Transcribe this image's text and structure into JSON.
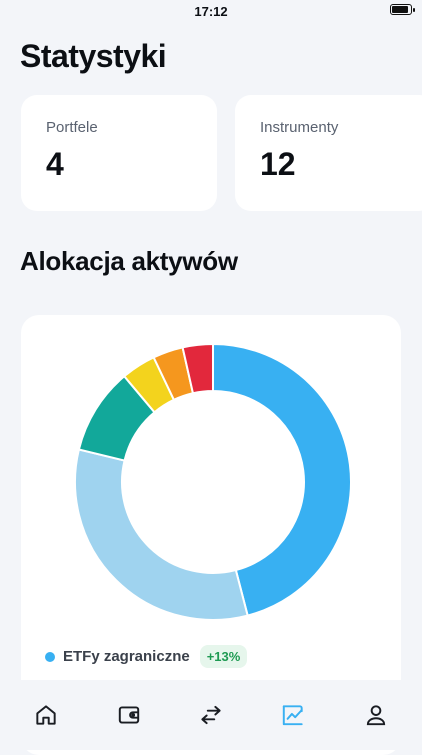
{
  "status": {
    "time": "17:12"
  },
  "page": {
    "title": "Statystyki"
  },
  "stats": [
    {
      "label": "Portfele",
      "value": "4"
    },
    {
      "label": "Instrumenty",
      "value": "12"
    }
  ],
  "allocation": {
    "title": "Alokacja aktywów"
  },
  "chart_data": {
    "type": "pie",
    "slices": [
      {
        "value": 45.5,
        "color": "#38b0f2"
      },
      {
        "value": 32.5,
        "color": "#9fd3ef"
      },
      {
        "value": 10,
        "color": "#12a89a"
      },
      {
        "value": 4,
        "color": "#f3d31d"
      },
      {
        "value": 3.5,
        "color": "#f5971e"
      },
      {
        "value": 3.5,
        "color": "#e2283c"
      }
    ]
  },
  "legend": [
    {
      "label": "ETFy zagraniczne",
      "badge": "+13%",
      "color": "#38b0f2"
    }
  ],
  "tabs": [
    {
      "name": "home-tab",
      "icon": "home-icon",
      "active": false
    },
    {
      "name": "portfolio-tab",
      "icon": "wallet-icon",
      "active": false
    },
    {
      "name": "transactions-tab",
      "icon": "transfer-icon",
      "active": false
    },
    {
      "name": "statistics-tab",
      "icon": "chart-icon",
      "active": true
    },
    {
      "name": "profile-tab",
      "icon": "person-icon",
      "active": false
    }
  ],
  "colors": {
    "accent": "#38b0f2",
    "inactive_tab": "#1a1d23"
  }
}
